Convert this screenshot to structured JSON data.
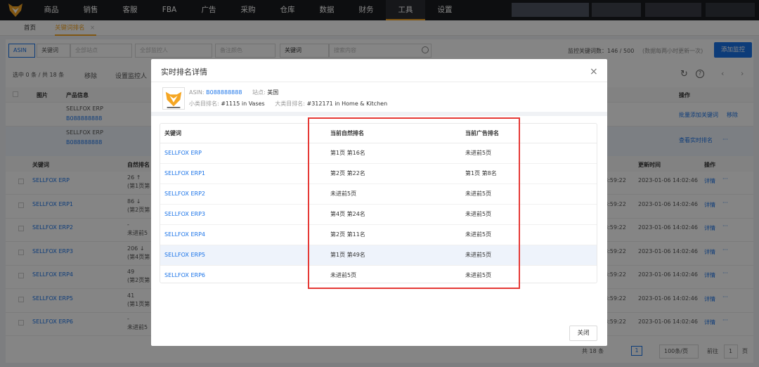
{
  "nav": {
    "items": [
      "商品",
      "销售",
      "客服",
      "FBA",
      "广告",
      "采购",
      "仓库",
      "数据",
      "财务",
      "工具",
      "设置"
    ],
    "active": "工具"
  },
  "tabs": [
    {
      "label": "首页"
    },
    {
      "label": "关键词排名",
      "close": "×"
    }
  ],
  "toolbar": {
    "type_selected": "ASIN",
    "type_other": "关键词",
    "site": "全部站点",
    "monitor": "全部监控人",
    "note": "备注颜色",
    "search_field": "关键词",
    "search_placeholder": "搜索内容",
    "count_text": "监控关键词数：146 / 500",
    "count_note": "(数据每两小时更新一次)",
    "add_button": "添加监控"
  },
  "list_bar": {
    "selection": "选中 0 条 / 共 18 条",
    "remove": "移除",
    "set_monitor": "设置监控人"
  },
  "bg_table": {
    "header": {
      "image": "图片",
      "product": "产品信息",
      "operation": "操作"
    },
    "products": [
      {
        "name": "SELLFOX ERP",
        "asin": "B088888888",
        "actions": [
          "批量添加关键词",
          "移除"
        ]
      },
      {
        "name": "SELLFOX ERP",
        "asin": "B088888888",
        "actions": [
          "查看实时排名",
          "···"
        ]
      }
    ],
    "sub_header": {
      "keyword": "关键词",
      "natural": "自然排名",
      "update": "更新时间",
      "operation": "操作"
    },
    "rows": [
      {
        "keyword": "SELLFOX ERP",
        "rank": "26 ↑",
        "sub": "(第1页第",
        "time": "8:59:22",
        "updated": "2023-01-06 14:02:46",
        "op": "详情"
      },
      {
        "keyword": "SELLFOX ERP1",
        "rank": "86 ↓",
        "sub": "(第2页第",
        "time": "8:59:22",
        "updated": "2023-01-06 14:02:46",
        "op": "详情"
      },
      {
        "keyword": "SELLFOX ERP2",
        "rank": "-",
        "sub": "未进前5",
        "time": "8:59:22",
        "updated": "2023-01-06 14:02:46",
        "op": "详情"
      },
      {
        "keyword": "SELLFOX ERP3",
        "rank": "206 ↓",
        "sub": "(第4页第",
        "time": "8:59:22",
        "updated": "2023-01-06 14:02:46",
        "op": "详情"
      },
      {
        "keyword": "SELLFOX ERP4",
        "rank": "49",
        "sub": "(第2页第",
        "time": "8:59:22",
        "updated": "2023-01-06 14:02:46",
        "op": "详情"
      },
      {
        "keyword": "SELLFOX ERP5",
        "rank": "41",
        "sub": "(第1页第",
        "time": "8:59:22",
        "updated": "2023-01-06 14:02:46",
        "op": "详情"
      },
      {
        "keyword": "SELLFOX ERP6",
        "rank": "-",
        "sub": "未进前5",
        "time": "8:59:22",
        "updated": "2023-01-06 14:02:46",
        "op": "详情"
      }
    ]
  },
  "pagination": {
    "total": "共 18 条",
    "current": "1",
    "page_size": "100条/页",
    "goto": "前往",
    "goto_value": "1",
    "page_unit": "页"
  },
  "modal": {
    "title": "实时排名详情",
    "close_icon": "×",
    "asin_label": "ASIN:",
    "asin": "B088888888",
    "site_label": "站点:",
    "site": "美国",
    "sub_rank_label": "小类目排名:",
    "sub_rank": "#1115 in Vases",
    "main_rank_label": "大类目排名:",
    "main_rank": "#312171 in Home & Kitchen",
    "table": {
      "headers": [
        "关键词",
        "当前自然排名",
        "当前广告排名"
      ],
      "rows": [
        [
          "SELLFOX ERP",
          "第1页 第16名",
          "未进前5页"
        ],
        [
          "SELLFOX ERP1",
          "第2页 第22名",
          "第1页 第8名"
        ],
        [
          "SELLFOX ERP2",
          "未进前5页",
          "未进前5页"
        ],
        [
          "SELLFOX ERP3",
          "第4页 第24名",
          "未进前5页"
        ],
        [
          "SELLFOX ERP4",
          "第2页 第11名",
          "未进前5页"
        ],
        [
          "SELLFOX ERP5",
          "第1页 第49名",
          "未进前5页"
        ],
        [
          "SELLFOX ERP6",
          "未进前5页",
          "未进前5页"
        ]
      ]
    },
    "close_button": "关闭"
  },
  "colors": {
    "accent": "#f5a623",
    "link": "#1a73e8",
    "highlight": "#e53935",
    "nav_bg": "#1a1b1f"
  }
}
